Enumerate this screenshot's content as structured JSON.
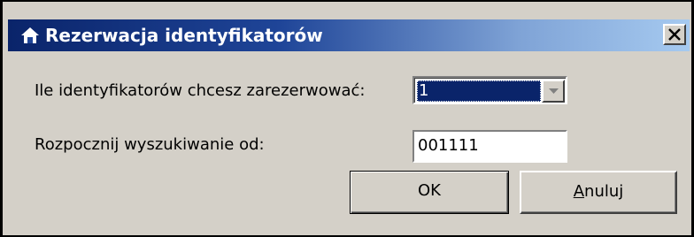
{
  "window": {
    "title": "Rezerwacja identyfikatorów",
    "close_glyph": "X",
    "icon": "home-icon"
  },
  "form": {
    "count_label": "Ile identyfikatorów chcesz zarezerwować:",
    "count_value": "1",
    "start_label": "Rozpocznij wyszukiwanie od:",
    "start_value": "001111"
  },
  "buttons": {
    "ok_label": "OK",
    "cancel_mnemonic": "A",
    "cancel_rest": "nuluj"
  },
  "colors": {
    "title_gradient_start": "#0a246a",
    "title_gradient_end": "#a6caf0",
    "dialog_face": "#d4d0c8",
    "selection": "#0a246a"
  }
}
